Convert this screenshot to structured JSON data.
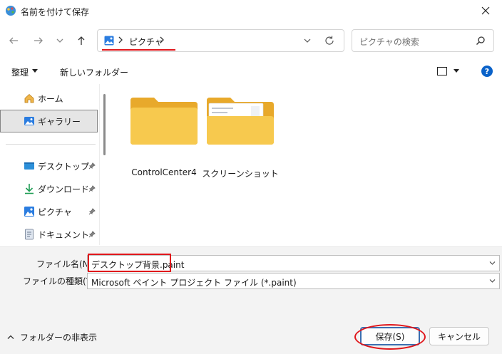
{
  "window": {
    "title": "名前を付けて保存"
  },
  "address": {
    "crumbs": [
      "ピクチャ"
    ]
  },
  "search": {
    "placeholder": "ピクチャの検索"
  },
  "toolbar": {
    "organize_label": "整理",
    "new_folder_label": "新しいフォルダー",
    "help_label": "?"
  },
  "sidebar": {
    "items": [
      {
        "label": "ホーム",
        "icon": "home-icon"
      },
      {
        "label": "ギャラリー",
        "icon": "gallery-icon",
        "selected": true
      },
      {
        "label": "デスクトップ",
        "icon": "desktop-icon",
        "pinned": true
      },
      {
        "label": "ダウンロード",
        "icon": "download-icon",
        "pinned": true
      },
      {
        "label": "ピクチャ",
        "icon": "pictures-icon",
        "pinned": true
      },
      {
        "label": "ドキュメント",
        "icon": "documents-icon",
        "pinned": true
      }
    ]
  },
  "content": {
    "items": [
      {
        "name": "ControlCenter4",
        "type": "folder"
      },
      {
        "name": "スクリーンショット",
        "type": "folder"
      }
    ]
  },
  "save_form": {
    "filename_label": "ファイル名(N):",
    "filename_value": "デスクトップ背景.paint",
    "filetype_label": "ファイルの種類(T):",
    "filetype_value": "Microsoft ペイント プロジェクト ファイル (*.paint)"
  },
  "footer": {
    "hide_folders_label": "フォルダーの非表示",
    "save_label": "保存(S)",
    "cancel_label": "キャンセル"
  },
  "colors": {
    "accent": "#0a62c9",
    "highlight": "#e0161b",
    "folder": "#f6c342"
  }
}
